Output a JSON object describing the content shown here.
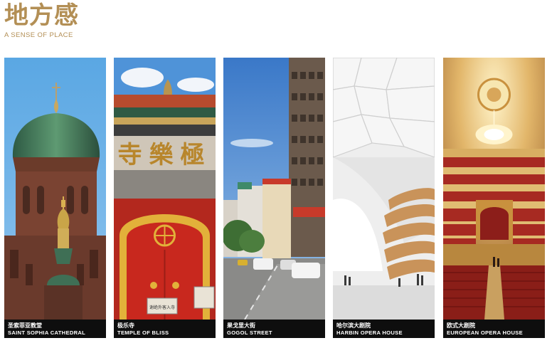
{
  "header": {
    "title": "地方感",
    "subtitle": "A SENSE OF PLACE"
  },
  "cards": [
    {
      "cn": "圣索菲亚教堂",
      "en": "SAINT SOPHIA CATHEDRAL",
      "image": "saint-sophia-cathedral-photo"
    },
    {
      "cn": "极乐寺",
      "en": "TEMPLE OF BLISS",
      "image": "temple-of-bliss-photo",
      "sign": "寺樂極",
      "plaque": "谢绝外客入寺"
    },
    {
      "cn": "果戈里大街",
      "en": "GOGOL STREET",
      "image": "gogol-street-photo"
    },
    {
      "cn": "哈尔滨大剧院",
      "en": "HARBIN OPERA HOUSE",
      "image": "harbin-opera-house-photo"
    },
    {
      "cn": "欧式大剧院",
      "en": "EUROPEAN OPERA HOUSE",
      "image": "european-opera-house-photo"
    }
  ],
  "colors": {
    "accent": "#b38f55",
    "caption_bg": "#0e0e0e"
  }
}
